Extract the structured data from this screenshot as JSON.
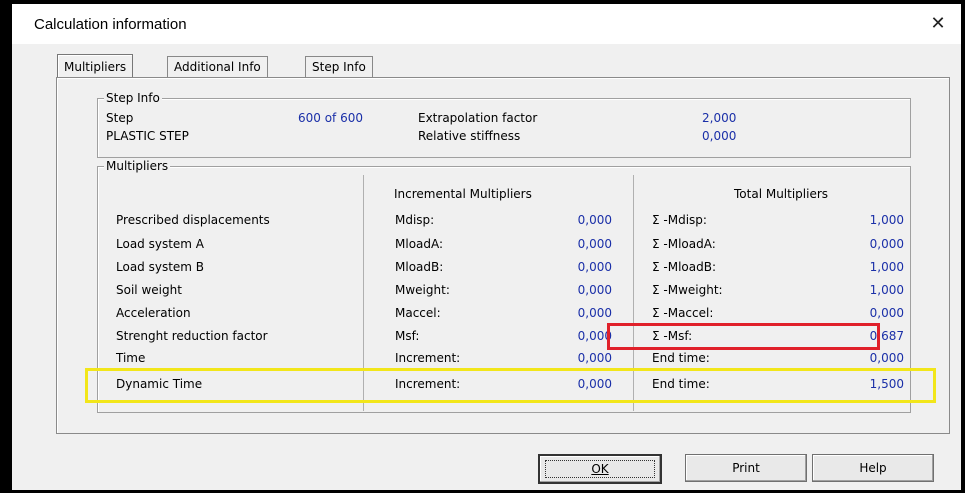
{
  "window": {
    "title": "Calculation information",
    "close_glyph": "✕"
  },
  "tabs": [
    "Multipliers",
    "Additional Info",
    "Step Info"
  ],
  "step_info": {
    "legend": "Step Info",
    "step_label": "Step",
    "step_value": "600 of 600",
    "step_type": "PLASTIC STEP",
    "extrapolation_label": "Extrapolation factor",
    "extrapolation_value": "2,000",
    "relative_stiffness_label": "Relative stiffness",
    "relative_stiffness_value": "0,000"
  },
  "multipliers": {
    "legend": "Multipliers",
    "incremental_header": "Incremental Multipliers",
    "total_header": "Total Multipliers",
    "rows": [
      {
        "label": "Prescribed displacements",
        "inc_label": "Mdisp:",
        "inc_value": "0,000",
        "total_label": "Σ -Mdisp:",
        "total_value": "1,000"
      },
      {
        "label": "Load system A",
        "inc_label": "MloadA:",
        "inc_value": "0,000",
        "total_label": "Σ -MloadA:",
        "total_value": "0,000"
      },
      {
        "label": "Load system B",
        "inc_label": "MloadB:",
        "inc_value": "0,000",
        "total_label": "Σ -MloadB:",
        "total_value": "1,000"
      },
      {
        "label": "Soil weight",
        "inc_label": "Mweight:",
        "inc_value": "0,000",
        "total_label": "Σ -Mweight:",
        "total_value": "1,000"
      },
      {
        "label": "Acceleration",
        "inc_label": "Maccel:",
        "inc_value": "0,000",
        "total_label": "Σ -Maccel:",
        "total_value": "0,000"
      },
      {
        "label": "Strenght reduction factor",
        "inc_label": "Msf:",
        "inc_value": "0,000",
        "total_label": "Σ -Msf:",
        "total_value": "0,687"
      },
      {
        "label": "Time",
        "inc_label": "Increment:",
        "inc_value": "0,000",
        "total_label": "End time:",
        "total_value": "0,000"
      },
      {
        "label": "Dynamic Time",
        "inc_label": "Increment:",
        "inc_value": "0,000",
        "total_label": "End time:",
        "total_value": "1,500"
      }
    ]
  },
  "buttons": {
    "ok": "OK",
    "print": "Print",
    "help": "Help"
  },
  "colors": {
    "value_blue": "#1a2fa8",
    "highlight_red": "#e0202a",
    "highlight_yellow": "#f2e61a"
  }
}
